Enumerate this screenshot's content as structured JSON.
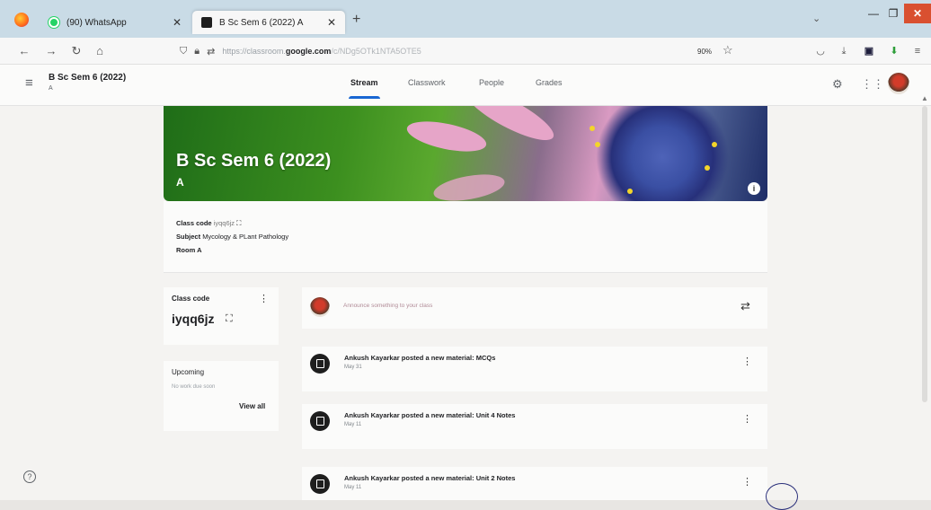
{
  "browser": {
    "tabs": [
      {
        "title": "(90) WhatsApp",
        "icon": "whatsapp-icon"
      },
      {
        "title": "B Sc Sem 6 (2022) A",
        "icon": "classroom-icon"
      }
    ],
    "url_scheme": "https://classroom.",
    "url_host": "google.com",
    "url_path": "/c/NDg5OTk1NTA5OTE5",
    "zoom": "90%"
  },
  "header": {
    "class_name": "B Sc Sem 6 (2022)",
    "section": "A",
    "tabs": [
      {
        "label": "Stream",
        "active": true
      },
      {
        "label": "Classwork",
        "active": false
      },
      {
        "label": "People",
        "active": false
      },
      {
        "label": "Grades",
        "active": false
      }
    ]
  },
  "banner": {
    "title": "B Sc Sem 6 (2022)",
    "section": "A"
  },
  "info": {
    "class_code_label": "Class code",
    "class_code_value": "iyqq6jz",
    "subject_label": "Subject",
    "subject_value": "Mycology & PLant Pathology",
    "room_label": "Room",
    "room_value": "A"
  },
  "sidebar": {
    "class_code_label": "Class code",
    "class_code": "iyqq6jz",
    "upcoming_label": "Upcoming",
    "upcoming_empty": "No work due soon",
    "view_all": "View all"
  },
  "stream": {
    "announce_placeholder": "Announce something to your class",
    "posts": [
      {
        "title": "Ankush Kayarkar posted a new material: MCQs",
        "date": "May 31"
      },
      {
        "title": "Ankush Kayarkar posted a new material: Unit 4 Notes",
        "date": "May 11"
      },
      {
        "title": "Ankush Kayarkar posted a new material: Unit 2 Notes",
        "date": "May 11"
      }
    ]
  },
  "colors": {
    "accent": "#1967d2",
    "close_button": "#d95030"
  }
}
